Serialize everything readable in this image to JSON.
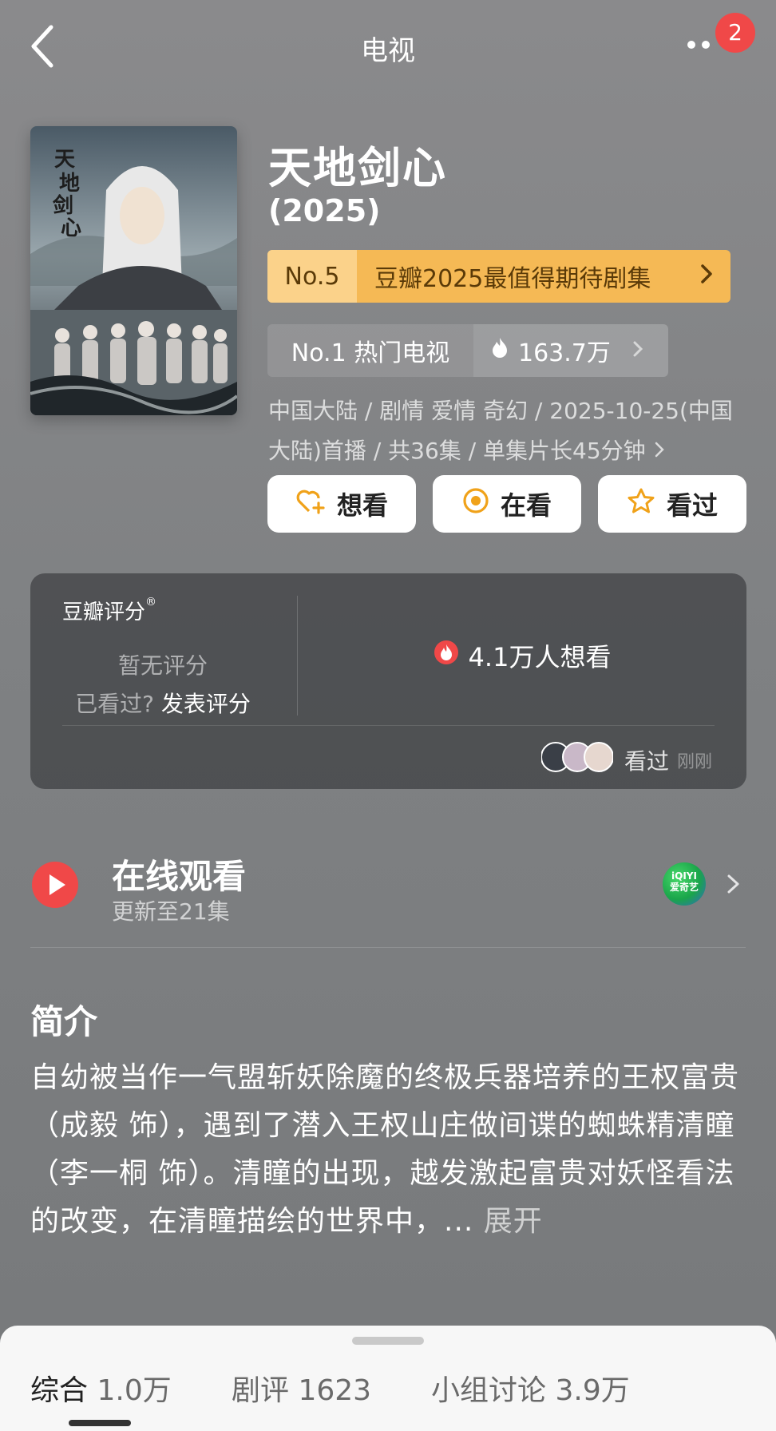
{
  "header": {
    "title": "电视",
    "notification_count": "2"
  },
  "show": {
    "name": "天地剑心",
    "year": "(2025)"
  },
  "rank": {
    "number": "No.5",
    "label": "豆瓣2025最值得期待剧集"
  },
  "hot": {
    "rank_label": "No.1 热门电视",
    "heat": "163.7万"
  },
  "meta": {
    "line1": "中国大陆 / 剧情 爱情 奇幻 / 2025-10-25(中国",
    "line2": "大陆)首播 / 共36集 / 单集片长45分钟"
  },
  "actions": {
    "want": "想看",
    "watching": "在看",
    "watched": "看过"
  },
  "rating": {
    "label": "豆瓣评分",
    "none": "暂无评分",
    "seen_question": "已看过?",
    "post_rating": "发表评分",
    "want_count": "4.1万人想看",
    "friends_watched": "看过",
    "time": "刚刚"
  },
  "online": {
    "title": "在线观看",
    "subtitle": "更新至21集",
    "provider_line1": "iQIYI",
    "provider_line2": "爱奇艺"
  },
  "intro": {
    "title": "简介",
    "text": "自幼被当作一气盟斩妖除魔的终极兵器培养的王权富贵（成毅 饰），遇到了潜入王权山庄做间谍的蜘蛛精清瞳（李一桐 饰）。清瞳的出现，越发激起富贵对妖怪看法的改变，在清瞳描绘的世界中，... ",
    "expand": "展开"
  },
  "tabs": [
    {
      "label": "综合",
      "count": "1.0万"
    },
    {
      "label": "剧评",
      "count": "1623"
    },
    {
      "label": "小组讨论",
      "count": "3.9万"
    }
  ],
  "colors": {
    "accent_red": "#f04848",
    "rank_gold": "#f5b955",
    "icon_orange": "#f0a21a"
  }
}
